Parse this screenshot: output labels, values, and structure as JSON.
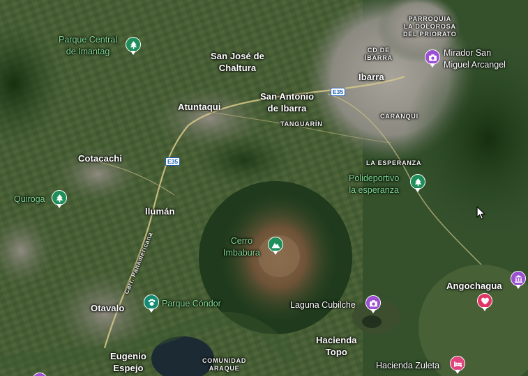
{
  "map": {
    "colors": {
      "forest": "#2c4a26",
      "forest_dark": "#1f3a1c",
      "farmland": "#4f6539",
      "urban": "#9a9690",
      "mountain": "#6e5338",
      "lake": "#1c2a33",
      "road": "#d8c98a",
      "poi_green": "#1e8e5a",
      "poi_purple": "#9b4fd1",
      "poi_red": "#e03464"
    },
    "places": {
      "san_jose": "San José de\nChaltura",
      "ibarra": "Ibarra",
      "atuntaqui": "Atuntaqui",
      "san_antonio": "San Antonio\nde Ibarra",
      "cotacachi": "Cotacachi",
      "iluman": "Ilumán",
      "otavalo": "Otavalo",
      "eugenio_espejo": "Eugenio\nEspejo",
      "hacienda_topo": "Hacienda\nTopo",
      "angochagua": "Angochagua"
    },
    "small_labels": {
      "parroquia": "PARROQUIA\nLA DOLOROSA\nDEL PRIORATO",
      "cd_ibarra": "CD DE\nIBARRA",
      "caranqui": "CARANQUI",
      "tanguarin": "TANGUARÍN",
      "la_esperanza": "LA ESPERANZA",
      "comunidad_araque": "COMUNIDAD\nARAQUE"
    },
    "pois": {
      "parque_central": "Parque Central\nde Imantag",
      "mirador": "Mirador San\nMiguel Arcangel",
      "polideportivo": "Polideportivo\nla esperanza",
      "quiroga": "Quiroga",
      "cerro_imbabura": "Cerro\nImbabura",
      "parque_condor": "Parque Cóndor",
      "laguna_cubilche": "Laguna Cubilche",
      "hacienda_zuleta": "Hacienda Zuleta"
    },
    "roads": {
      "e35_a": "E35",
      "e35_b": "E35",
      "panamericana": "Carr. Panamericana"
    },
    "icons": {
      "park": "tree-icon",
      "mountain": "mountain-icon",
      "camera": "camera-icon",
      "paw": "paw-icon",
      "heart": "heart-icon",
      "museum": "museum-icon",
      "hotel": "bed-icon",
      "cursor": "mouse-cursor-icon"
    }
  }
}
